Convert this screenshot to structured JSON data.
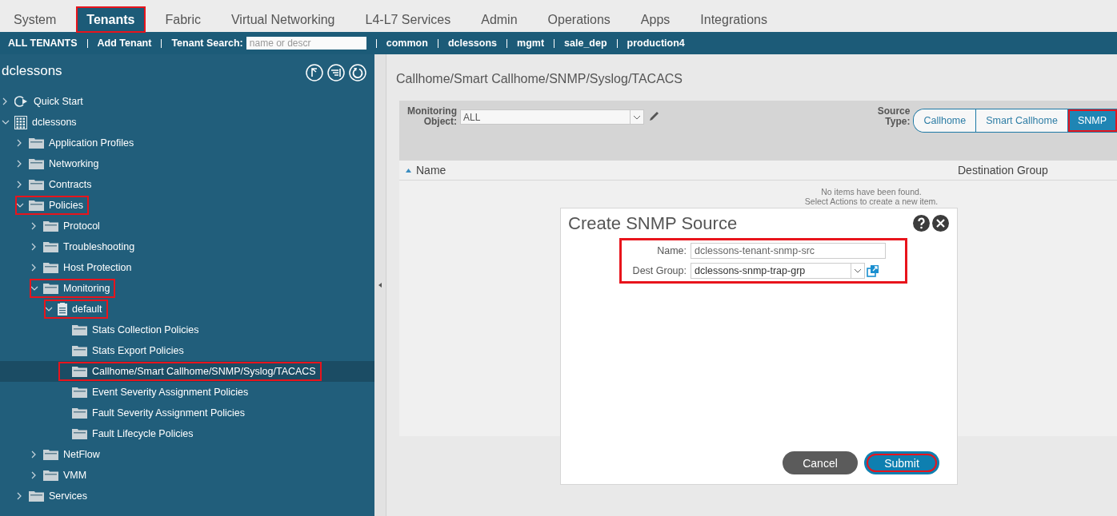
{
  "top_tabs": [
    {
      "label": "System",
      "selected": false,
      "highlighted": false
    },
    {
      "label": "Tenants",
      "selected": true,
      "highlighted": true
    },
    {
      "label": "Fabric",
      "selected": false,
      "highlighted": false
    },
    {
      "label": "Virtual Networking",
      "selected": false,
      "highlighted": false
    },
    {
      "label": "L4-L7 Services",
      "selected": false,
      "highlighted": false
    },
    {
      "label": "Admin",
      "selected": false,
      "highlighted": false
    },
    {
      "label": "Operations",
      "selected": false,
      "highlighted": false
    },
    {
      "label": "Apps",
      "selected": false,
      "highlighted": false
    },
    {
      "label": "Integrations",
      "selected": false,
      "highlighted": false
    }
  ],
  "tenant_bar": {
    "links": [
      "ALL TENANTS",
      "Add Tenant"
    ],
    "search_label": "Tenant Search:",
    "search_placeholder": "name or descr",
    "tenants": [
      "common",
      "dclessons",
      "mgmt",
      "sale_dep",
      "production4"
    ]
  },
  "sidebar": {
    "title": "dclessons",
    "tree": [
      {
        "label": "Quick Start",
        "kind": "quickstart",
        "expanded": false,
        "selected": false,
        "highlighted": false
      },
      {
        "label": "dclessons",
        "kind": "tenant",
        "expanded": true,
        "selected": false,
        "highlighted": false,
        "children": [
          {
            "label": "Application Profiles",
            "kind": "folder",
            "expanded": false,
            "selected": false,
            "highlighted": false
          },
          {
            "label": "Networking",
            "kind": "folder",
            "expanded": false,
            "selected": false,
            "highlighted": false
          },
          {
            "label": "Contracts",
            "kind": "folder",
            "expanded": false,
            "selected": false,
            "highlighted": false
          },
          {
            "label": "Policies",
            "kind": "folder",
            "expanded": true,
            "selected": false,
            "highlighted": true,
            "children": [
              {
                "label": "Protocol",
                "kind": "folder",
                "expanded": false,
                "selected": false,
                "highlighted": false
              },
              {
                "label": "Troubleshooting",
                "kind": "folder",
                "expanded": false,
                "selected": false,
                "highlighted": false
              },
              {
                "label": "Host Protection",
                "kind": "folder",
                "expanded": false,
                "selected": false,
                "highlighted": false
              },
              {
                "label": "Monitoring",
                "kind": "folder",
                "expanded": true,
                "selected": false,
                "highlighted": true,
                "children": [
                  {
                    "label": "default",
                    "kind": "policy",
                    "expanded": true,
                    "selected": false,
                    "highlighted": true,
                    "children": [
                      {
                        "label": "Stats Collection Policies",
                        "kind": "folder",
                        "selected": false,
                        "highlighted": false
                      },
                      {
                        "label": "Stats Export Policies",
                        "kind": "folder",
                        "selected": false,
                        "highlighted": false
                      },
                      {
                        "label": "Callhome/Smart Callhome/SNMP/Syslog/TACACS",
                        "kind": "folder",
                        "selected": true,
                        "highlighted": true
                      },
                      {
                        "label": "Event Severity Assignment Policies",
                        "kind": "folder",
                        "selected": false,
                        "highlighted": false
                      },
                      {
                        "label": "Fault Severity Assignment Policies",
                        "kind": "folder",
                        "selected": false,
                        "highlighted": false
                      },
                      {
                        "label": "Fault Lifecycle Policies",
                        "kind": "folder",
                        "selected": false,
                        "highlighted": false
                      }
                    ]
                  }
                ]
              },
              {
                "label": "NetFlow",
                "kind": "folder",
                "expanded": false,
                "selected": false,
                "highlighted": false
              },
              {
                "label": "VMM",
                "kind": "folder",
                "expanded": false,
                "selected": false,
                "highlighted": false
              }
            ]
          },
          {
            "label": "Services",
            "kind": "folder",
            "expanded": false,
            "selected": false,
            "highlighted": false
          }
        ]
      }
    ]
  },
  "content": {
    "title": "Callhome/Smart Callhome/SNMP/Syslog/TACACS",
    "monitoring_object": {
      "label": "Monitoring Object:",
      "value": "ALL"
    },
    "source_type": {
      "label": "Source Type:",
      "options": [
        {
          "label": "Callhome",
          "selected": false,
          "highlighted": false
        },
        {
          "label": "Smart Callhome",
          "selected": false,
          "highlighted": false
        },
        {
          "label": "SNMP",
          "selected": true,
          "highlighted": true
        }
      ]
    },
    "table": {
      "columns": [
        {
          "label": "Name",
          "sorted": true
        },
        {
          "label": "Destination Group",
          "sorted": false
        }
      ],
      "empty_message": [
        "No items have been found.",
        "Select Actions to create a new item."
      ]
    }
  },
  "dialog": {
    "title": "Create SNMP Source",
    "fields_highlighted": true,
    "fields": [
      {
        "label": "Name:",
        "value": "dclessons-tenant-snmp-src",
        "kind": "text"
      },
      {
        "label": "Dest Group:",
        "value": "dclessons-snmp-trap-grp",
        "kind": "select"
      }
    ],
    "buttons": [
      {
        "label": "Cancel",
        "kind": "cancel",
        "highlighted": false
      },
      {
        "label": "Submit",
        "kind": "submit",
        "highlighted": true
      }
    ]
  }
}
